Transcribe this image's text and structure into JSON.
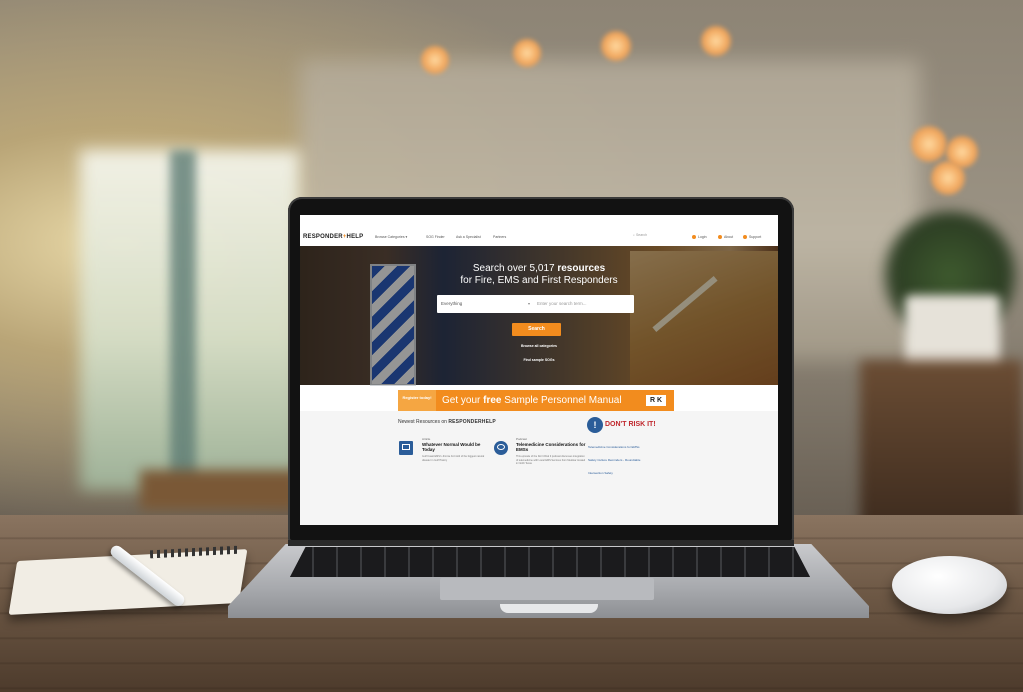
{
  "site": {
    "logo_main": "RESPONDER",
    "logo_accent": "HELP",
    "nav": [
      "Browse Categories ▾",
      "SOG Finder",
      "Ask a Specialist",
      "Partners"
    ],
    "search_placeholder": "Search",
    "nav_right": [
      "Login",
      "About",
      "Support"
    ]
  },
  "hero": {
    "headline_prefix": "Search over 5,017 ",
    "headline_bold": "resources",
    "headline_line2": "for Fire, EMS and First Responders",
    "category_select": "Everything",
    "search_input_placeholder": "Enter your search term...",
    "search_button": "Search",
    "link_categories": "Browse all categories",
    "link_sogs": "Find sample SOGs"
  },
  "banner": {
    "cta": "Register today!",
    "text_pre": "Get your ",
    "text_bold": "free",
    "text_post": " Sample Personnel Manual",
    "logo": "R K"
  },
  "newest": {
    "label": "Newest Resources on ",
    "brand": "RESPONDERHELP",
    "cards": [
      {
        "type": "Article",
        "title": "Whatever Normal Would be Today",
        "desc": "Gulf Coast EMS's Jimmie Fort told of the biggest natural disaster in Gulf History"
      },
      {
        "type": "Podcast",
        "title": "Telemedicine Considerations for EMSs",
        "desc": "This episode of the Don't Risk It podcast discusses integration of telemedicine with Local EMS Services from Medstar located in North Texas"
      }
    ]
  },
  "sidebar": {
    "logo_mark": "!",
    "logo_text": "DON'T RISK IT!",
    "links": [
      "Telemedicine Considerations for EMSs",
      "Safety Culture Reminders - Roundtable",
      "Intersection Safety"
    ]
  }
}
